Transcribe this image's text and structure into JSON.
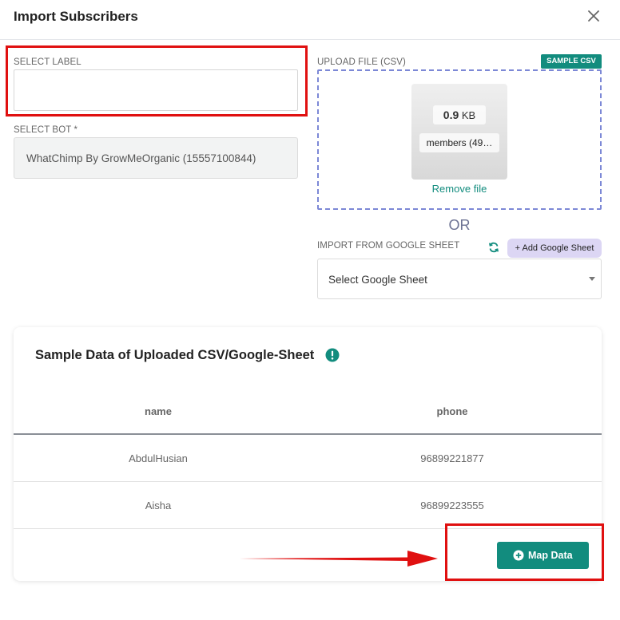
{
  "dialog": {
    "title": "Import Subscribers"
  },
  "label_field": {
    "label": "SELECT LABEL",
    "value": ""
  },
  "bot_field": {
    "label": "SELECT BOT *",
    "value": "WhatChimp By GrowMeOrganic (15557100844)"
  },
  "upload": {
    "label": "UPLOAD FILE (CSV)",
    "sample_button": "SAMPLE CSV",
    "file_size_value": "0.9",
    "file_size_unit": "KB",
    "file_name": "members (49…",
    "remove_label": "Remove file"
  },
  "or_text": "OR",
  "google_sheet": {
    "label": "IMPORT FROM GOOGLE SHEET",
    "add_button": "+ Add Google Sheet",
    "selected": "Select Google Sheet"
  },
  "sample_table": {
    "title": "Sample Data of Uploaded CSV/Google-Sheet",
    "columns": [
      "name",
      "phone"
    ],
    "rows": [
      [
        "AbdulHusian",
        "96899221877"
      ],
      [
        "Aisha",
        "96899223555"
      ]
    ]
  },
  "map_button": "Map Data",
  "colors": {
    "accent": "#128c7e",
    "dropzone_border": "#7c88d6",
    "highlight": "#e01010"
  }
}
